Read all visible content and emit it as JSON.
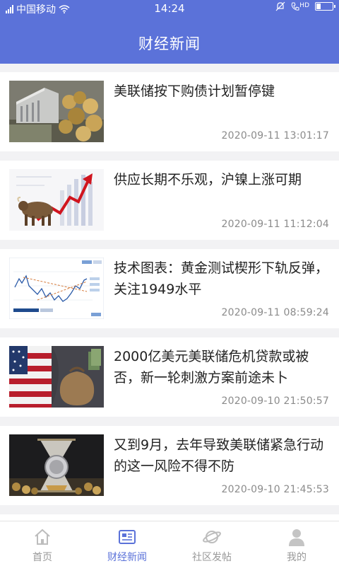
{
  "status_bar": {
    "carrier": "中国移动",
    "time": "14:24",
    "network": "HD"
  },
  "header": {
    "title": "财经新闻"
  },
  "news": [
    {
      "headline": "美联储按下购债计划暂停键",
      "time": "2020-09-11 13:01:17",
      "image": "money-building-thumb"
    },
    {
      "headline": "供应长期不乐观，沪镍上涨可期",
      "time": "2020-09-11 11:12:04",
      "image": "bull-chart-thumb"
    },
    {
      "headline": "技术图表：黄金测试楔形下轨反弹，关注1949水平",
      "time": "2020-09-11 08:59:24",
      "image": "price-chart-thumb"
    },
    {
      "headline": "2000亿美元美联储危机贷款或被否，新一轮刺激方案前途未卜",
      "time": "2020-09-10 21:50:57",
      "image": "flag-moneybag-thumb"
    },
    {
      "headline": "又到9月，去年导致美联储紧急行动的这一风险不得不防",
      "time": "2020-09-10 21:45:53",
      "image": "gold-hourglass-thumb"
    }
  ],
  "tabs": [
    {
      "label": "首页",
      "icon": "home-icon",
      "active": false
    },
    {
      "label": "财经新闻",
      "icon": "news-icon",
      "active": true
    },
    {
      "label": "社区发帖",
      "icon": "planet-icon",
      "active": false
    },
    {
      "label": "我的",
      "icon": "user-icon",
      "active": false
    }
  ],
  "colors": {
    "brand": "#5b72d9",
    "tab_inactive": "#999999"
  }
}
